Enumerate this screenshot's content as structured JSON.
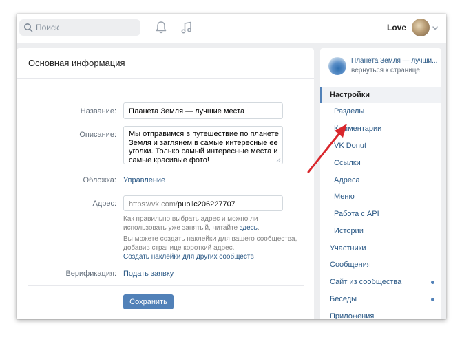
{
  "header": {
    "search_placeholder": "Поиск",
    "user_name": "Love"
  },
  "main": {
    "title": "Основная информация",
    "name_label": "Название:",
    "name_value": "Планета Земля — лучшие места",
    "description_label": "Описание:",
    "description_value": "Мы отправимся в путешествие по планете Земля и заглянем в самые интересные ее уголки. Только самый интересные места и самые красивые фото!",
    "cover_label": "Обложка:",
    "cover_link": "Управление",
    "address_label": "Адрес:",
    "address_prefix": "https://vk.com/",
    "address_value": "public206227707",
    "hint_1_text": "Как правильно выбрать адрес и можно ли использовать уже занятый, читайте",
    "hint_1_link": "здесь",
    "hint_1_end": ".",
    "hint_2_text": "Вы можете создать наклейки для вашего сообщества, добавив странице короткий адрес.",
    "hint_2_link": "Создать наклейки для других сообществ",
    "verification_label": "Верификация:",
    "verification_link": "Подать заявку",
    "save_button": "Сохранить"
  },
  "sidebar": {
    "community_name": "Планета Земля — лучши...",
    "back_link": "вернуться к странице",
    "items": [
      {
        "label": "Настройки",
        "active": true
      },
      {
        "label": "Разделы"
      },
      {
        "label": "Комментарии"
      },
      {
        "label": "VK Donut"
      },
      {
        "label": "Ссылки"
      },
      {
        "label": "Адреса"
      },
      {
        "label": "Меню"
      },
      {
        "label": "Работа с API"
      },
      {
        "label": "Истории"
      },
      {
        "label": "Участники"
      },
      {
        "label": "Сообщения"
      },
      {
        "label": "Сайт из сообщества",
        "dot": true
      },
      {
        "label": "Беседы",
        "dot": true
      },
      {
        "label": "Приложения"
      }
    ]
  },
  "colors": {
    "accent": "#5181b8",
    "link": "#2a5885",
    "annotation_arrow": "#d9262c"
  }
}
